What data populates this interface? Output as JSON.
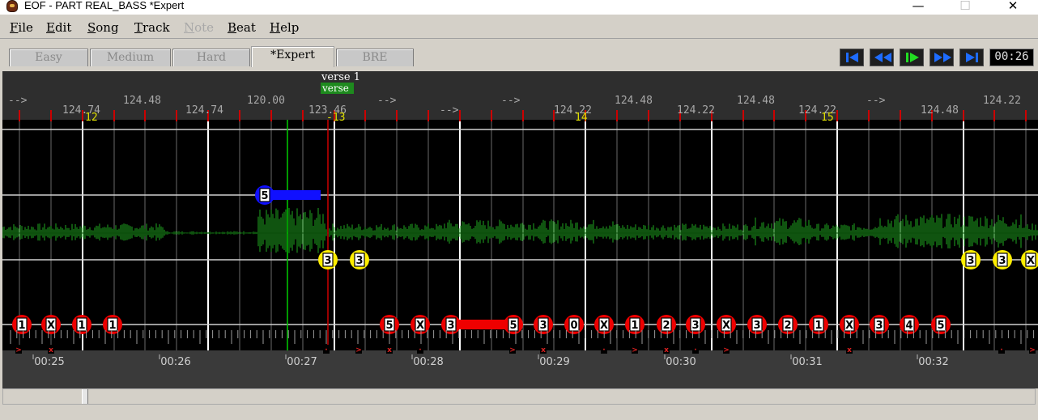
{
  "window": {
    "title": "EOF - PART REAL_BASS  *Expert",
    "minimize_glyph": "—",
    "maximize_glyph": "☐",
    "close_glyph": "✕"
  },
  "menu": [
    "File",
    "Edit",
    "Song",
    "Track",
    "Note",
    "Beat",
    "Help"
  ],
  "tabs": [
    "Easy",
    "Medium",
    "Hard",
    "*Expert",
    "BRE"
  ],
  "active_tab": "*Expert",
  "transport_icons": [
    "skip-to-start-icon",
    "rewind-icon",
    "play-icon",
    "fast-forward-icon",
    "skip-to-end-icon"
  ],
  "time_display": "00:26",
  "editor": {
    "section": {
      "title": "verse 1",
      "tag": "verse"
    },
    "tempo_labels": [
      "-->",
      "124.74",
      "124.48",
      "124.74",
      "120.00",
      "123.46",
      "-->",
      "-->",
      "-->",
      "124.22",
      "124.48",
      "124.22",
      "124.48",
      "124.22",
      "-->",
      "124.48",
      "124.22"
    ],
    "measure_numbers": [
      "12",
      "-13",
      "14",
      "15"
    ],
    "time_labels": [
      "00:25",
      "00:26",
      "00:27",
      "00:28",
      "00:29",
      "00:30",
      "00:31",
      "00:32"
    ],
    "blue_lane_note": "5",
    "yellow_lane_notes": [
      "3",
      "3",
      "3",
      "3",
      "X"
    ],
    "red_lane_notes": [
      "1",
      "X",
      "1",
      "1",
      "5",
      "X",
      "3",
      "5",
      "3",
      "0",
      "X",
      "1",
      "2",
      "3",
      "X",
      "3",
      "2",
      "1",
      "X",
      "3",
      "4",
      "5"
    ]
  },
  "colors": {
    "editor_bg": "#000000",
    "beat_marker": "#cc0000",
    "measure_number": "#e0e000",
    "waveform": "#1fa81f",
    "seek_line": "#00cc00",
    "blue_note": "#1010ff",
    "yellow_note": "#ffee00",
    "red_note": "#ee0000",
    "section_tag_bg": "#1e8a1e"
  }
}
